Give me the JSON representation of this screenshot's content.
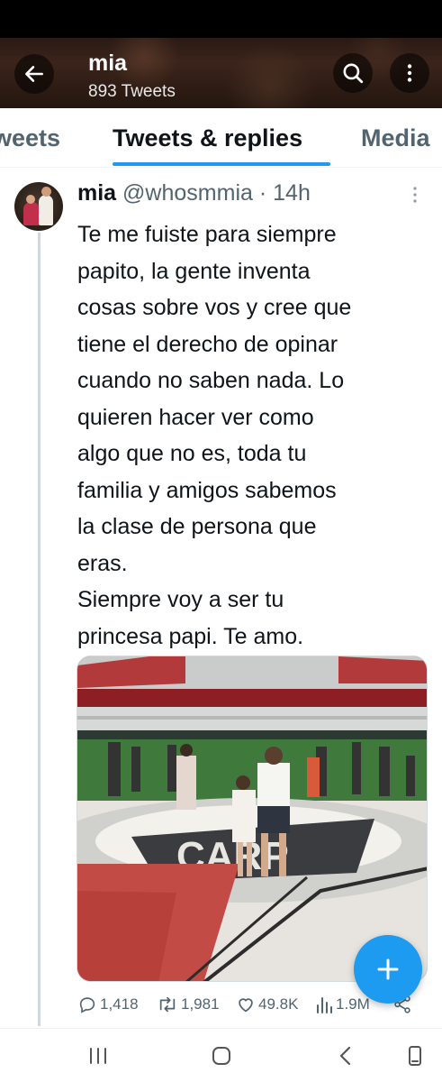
{
  "header": {
    "title": "mia",
    "subtitle": "893 Tweets",
    "icons": {
      "back": "arrow-left-icon",
      "search": "search-icon",
      "more": "more-vertical-icon"
    }
  },
  "tabs": [
    {
      "label": "Tweets",
      "selected": false,
      "shown": "weets"
    },
    {
      "label": "Tweets & replies",
      "selected": true
    },
    {
      "label": "Media",
      "selected": false
    }
  ],
  "tweet": {
    "display_name": "mia",
    "handle": "@whosmmia",
    "separator": "·",
    "time": "14h",
    "text": "Te me fuiste para siempre\npapito, la gente inventa\ncosas sobre vos y cree que\ntiene el derecho de opinar\ncuando no saben nada. Lo\nquieren hacer ver como\nalgo que no es, toda tu\nfamilia y amigos sabemos\nla clase de persona que\neras.\nSiempre voy a ser tu\nprincesa papi. Te amo.",
    "stats": {
      "replies": "1,418",
      "retweets": "1,981",
      "likes": "49.8K",
      "views": "1.9M"
    }
  },
  "colors": {
    "accent": "#1d9bf0",
    "text_primary": "#0f1419",
    "text_secondary": "#536471",
    "divider": "#cfd9de"
  },
  "fab": {
    "icon": "plus-icon"
  },
  "nav_bar": {
    "icons": [
      "recent-apps-icon",
      "home-icon",
      "back-icon",
      "rotate-icon"
    ]
  }
}
